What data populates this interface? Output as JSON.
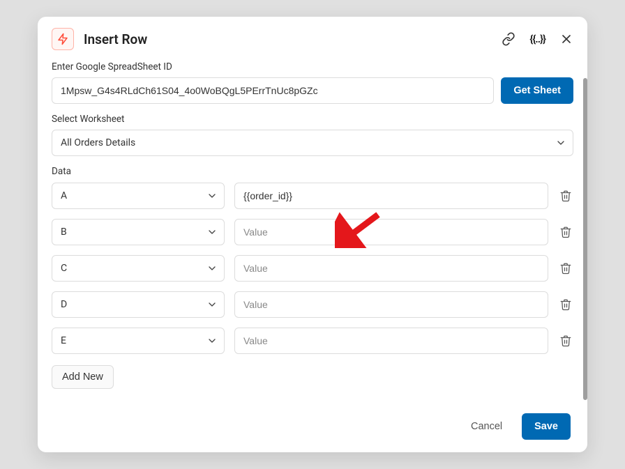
{
  "modal": {
    "title": "Insert Row"
  },
  "fields": {
    "spreadsheet_id": {
      "label": "Enter Google SpreadSheet ID",
      "value": "1Mpsw_G4s4RLdCh61S04_4o0WoBQgL5PErrTnUc8pGZc",
      "button": "Get Sheet"
    },
    "worksheet": {
      "label": "Select Worksheet",
      "value": "All Orders Details"
    },
    "data_label": "Data"
  },
  "rows": [
    {
      "column": "A",
      "value": "{{order_id}}",
      "placeholder": "Value"
    },
    {
      "column": "B",
      "value": "",
      "placeholder": "Value"
    },
    {
      "column": "C",
      "value": "",
      "placeholder": "Value"
    },
    {
      "column": "D",
      "value": "",
      "placeholder": "Value"
    },
    {
      "column": "E",
      "value": "",
      "placeholder": "Value"
    }
  ],
  "buttons": {
    "add_new": "Add New",
    "cancel": "Cancel",
    "save": "Save"
  }
}
